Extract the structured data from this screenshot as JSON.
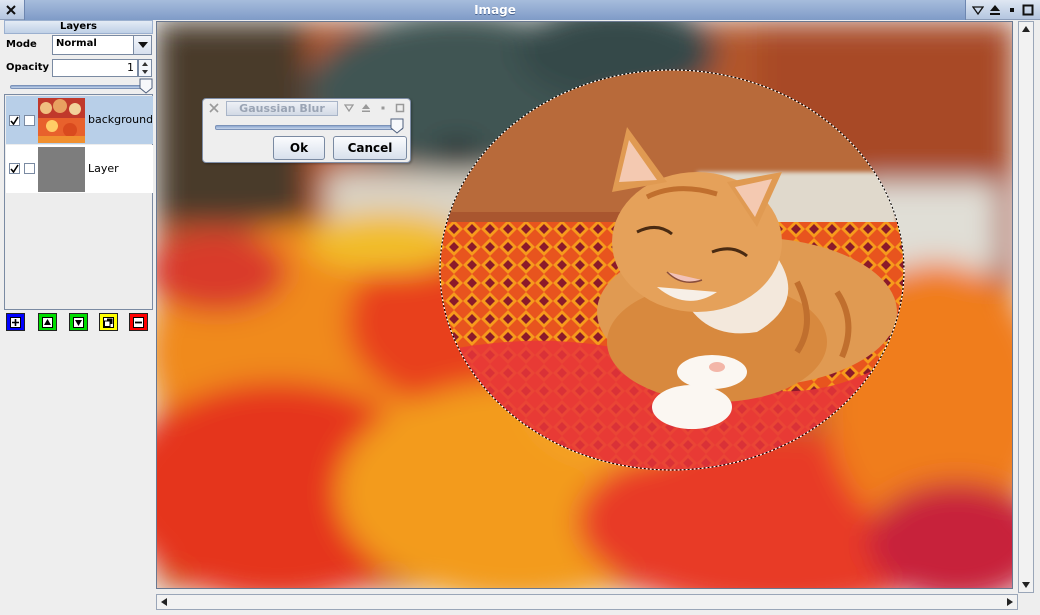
{
  "window": {
    "title": "Image"
  },
  "layers_panel": {
    "title": "Layers",
    "mode_label": "Mode",
    "mode_value": "Normal",
    "opacity_label": "Opacity",
    "opacity_value": "1",
    "opacity_slider_fraction": 1.0,
    "layers": [
      {
        "name": "background",
        "visible": true,
        "linked": false,
        "selected": true
      },
      {
        "name": "Layer",
        "visible": true,
        "linked": false,
        "selected": false
      }
    ],
    "buttons": [
      {
        "icon": "plus-icon",
        "color": "#0000ff"
      },
      {
        "icon": "arrow-up-icon",
        "color": "#00dd00"
      },
      {
        "icon": "arrow-down-icon",
        "color": "#00dd00"
      },
      {
        "icon": "duplicate-icon",
        "color": "#ffff00"
      },
      {
        "icon": "minus-icon",
        "color": "#ff0000"
      }
    ]
  },
  "dialog": {
    "title": "Gaussian Blur",
    "slider_fraction": 0.98,
    "ok_label": "Ok",
    "cancel_label": "Cancel"
  },
  "colors": {
    "title_bar": "#8fa9d2",
    "selected_layer": "#b8cfe8"
  }
}
